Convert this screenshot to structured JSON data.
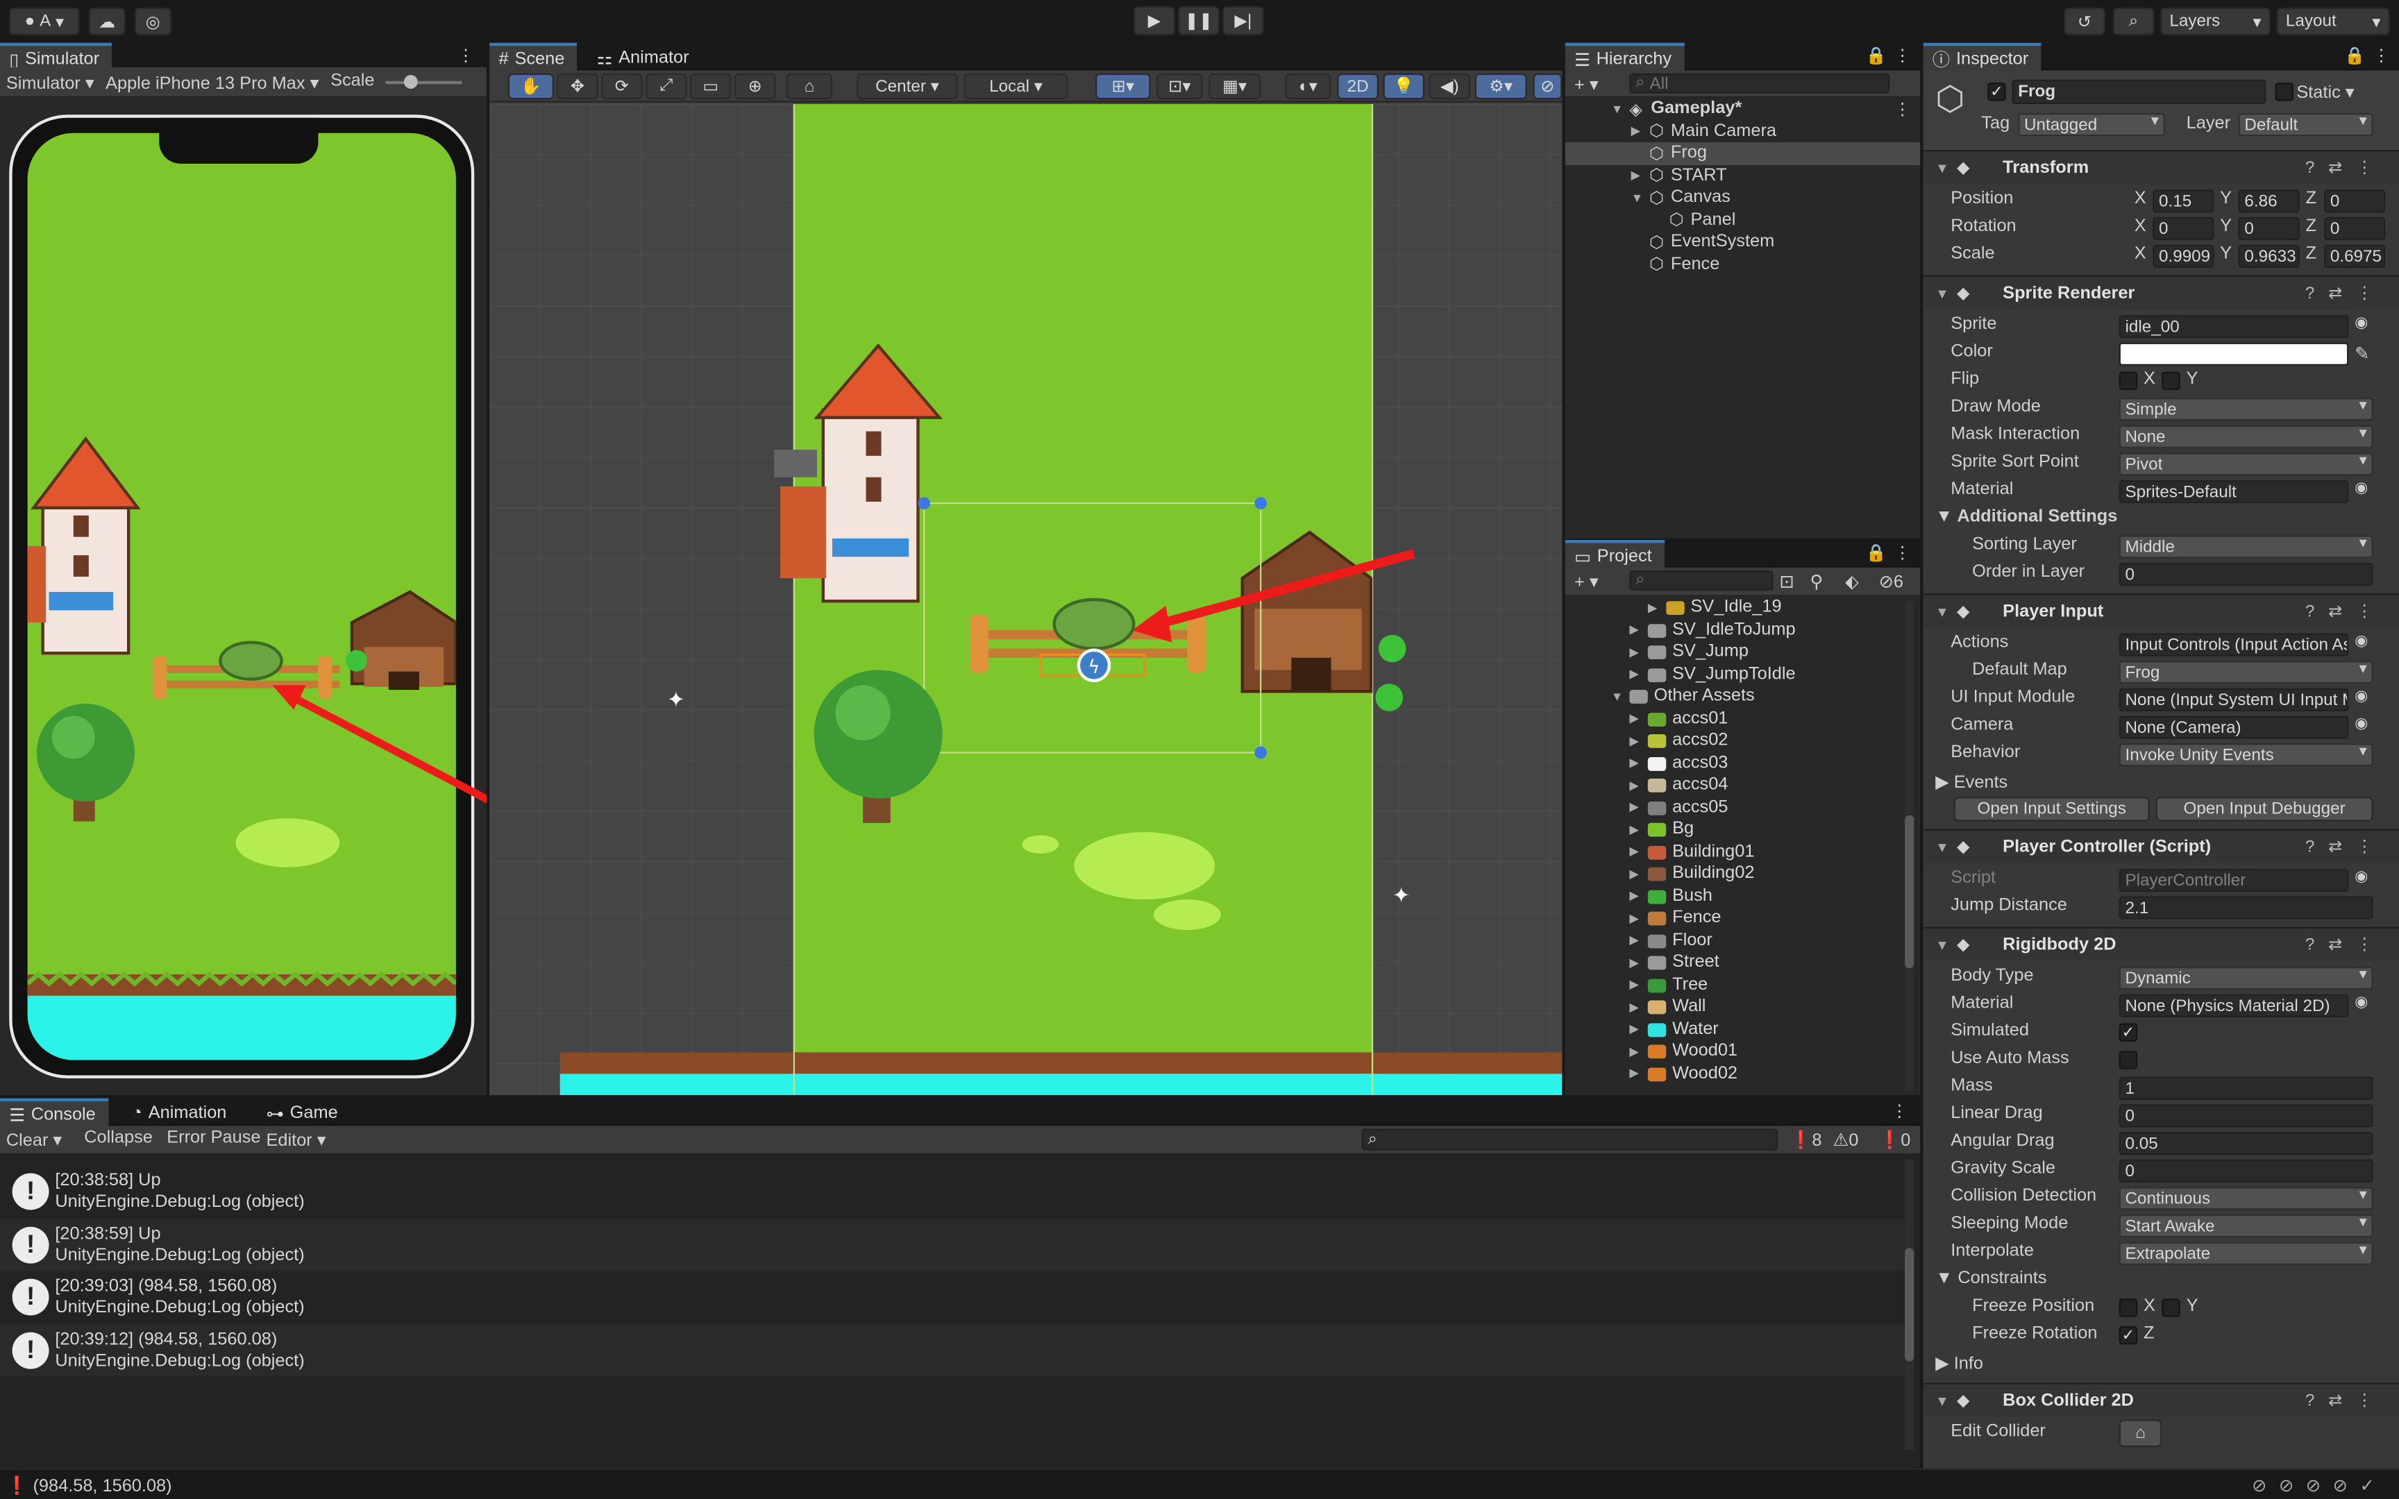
{
  "topbar": {
    "account": "A",
    "layers": "Layers",
    "layout": "Layout"
  },
  "simulator": {
    "tab": "Simulator",
    "mode": "Simulator",
    "device": "Apple iPhone 13 Pro Max",
    "scale_label": "Scale"
  },
  "scene": {
    "tabs": [
      "Scene",
      "Animator"
    ],
    "pivot": "Center",
    "space": "Local",
    "mode2d": "2D"
  },
  "hierarchy": {
    "tab": "Hierarchy",
    "search_placeholder": "All",
    "items": [
      {
        "label": "Gameplay*",
        "indent": 0
      },
      {
        "label": "Main Camera",
        "indent": 1
      },
      {
        "label": "Frog",
        "indent": 1
      },
      {
        "label": "START",
        "indent": 1
      },
      {
        "label": "Canvas",
        "indent": 1
      },
      {
        "label": "Panel",
        "indent": 2
      },
      {
        "label": "EventSystem",
        "indent": 1
      },
      {
        "label": "Fence",
        "indent": 1
      }
    ]
  },
  "project": {
    "tab": "Project",
    "hidden_count": "6",
    "items": [
      {
        "label": "SV_Idle_19",
        "indent": 3,
        "color": "#c9a227"
      },
      {
        "label": "SV_IdleToJump",
        "indent": 2,
        "color": "#b8b8b8"
      },
      {
        "label": "SV_Jump",
        "indent": 2,
        "color": "#b8b8b8"
      },
      {
        "label": "SV_JumpToIdle",
        "indent": 2,
        "color": "#b8b8b8"
      },
      {
        "label": "Other Assets",
        "indent": 1,
        "color": "#b8b8b8"
      },
      {
        "label": "accs01",
        "indent": 2,
        "color": "#6aa82f"
      },
      {
        "label": "accs02",
        "indent": 2,
        "color": "#b9c23a"
      },
      {
        "label": "accs03",
        "indent": 2,
        "color": "#f2f2f2"
      },
      {
        "label": "accs04",
        "indent": 2,
        "color": "#c8b89a"
      },
      {
        "label": "accs05",
        "indent": 2,
        "color": "#808080"
      },
      {
        "label": "Bg",
        "indent": 2,
        "color": "#7cc22b"
      },
      {
        "label": "Building01",
        "indent": 2,
        "color": "#c65a3a"
      },
      {
        "label": "Building02",
        "indent": 2,
        "color": "#8a5a3a"
      },
      {
        "label": "Bush",
        "indent": 2,
        "color": "#3fae3a"
      },
      {
        "label": "Fence",
        "indent": 2,
        "color": "#c07a3a"
      },
      {
        "label": "Floor",
        "indent": 2,
        "color": "#8a8a8a"
      },
      {
        "label": "Street",
        "indent": 2,
        "color": "#9a9a9a"
      },
      {
        "label": "Tree",
        "indent": 2,
        "color": "#3a9a3a"
      },
      {
        "label": "Wall",
        "indent": 2,
        "color": "#d8b070"
      },
      {
        "label": "Water",
        "indent": 2,
        "color": "#2fe3e0"
      },
      {
        "label": "Wood01",
        "indent": 2,
        "color": "#d87a2a"
      },
      {
        "label": "Wood02",
        "indent": 2,
        "color": "#d87a2a"
      }
    ]
  },
  "console": {
    "tabs": [
      "Console",
      "Animation",
      "Game"
    ],
    "buttons": [
      "Clear",
      "Collapse",
      "Error Pause",
      "Editor"
    ],
    "counts": {
      "info": "8",
      "warn": "0",
      "error": "0"
    },
    "logs": [
      {
        "line1": "[20:38:58] Up",
        "line2": "UnityEngine.Debug:Log (object)"
      },
      {
        "line1": "[20:38:59] Up",
        "line2": "UnityEngine.Debug:Log (object)"
      },
      {
        "line1": "[20:39:03] (984.58, 1560.08)",
        "line2": "UnityEngine.Debug:Log (object)"
      },
      {
        "line1": "[20:39:12] (984.58, 1560.08)",
        "line2": "UnityEngine.Debug:Log (object)"
      }
    ]
  },
  "status": "(984.58, 1560.08)",
  "inspector": {
    "tab": "Inspector",
    "object_name": "Frog",
    "static_label": "Static",
    "tag_label": "Tag",
    "tag": "Untagged",
    "layer_label": "Layer",
    "layer": "Default",
    "transform": {
      "title": "Transform",
      "rows": [
        {
          "label": "Position",
          "x": "0.15",
          "y": "6.86",
          "z": "0"
        },
        {
          "label": "Rotation",
          "x": "0",
          "y": "0",
          "z": "0"
        },
        {
          "label": "Scale",
          "x": "0.9909",
          "y": "0.9633",
          "z": "0.6975"
        }
      ]
    },
    "sprite_renderer": {
      "title": "Sprite Renderer",
      "fields": [
        {
          "label": "Sprite",
          "value": "idle_00",
          "kind": "obj"
        },
        {
          "label": "Color",
          "value": "",
          "kind": "color"
        },
        {
          "label": "Flip",
          "value": "",
          "kind": "flip"
        },
        {
          "label": "Draw Mode",
          "value": "Simple",
          "kind": "dd"
        },
        {
          "label": "Mask Interaction",
          "value": "None",
          "kind": "dd"
        },
        {
          "label": "Sprite Sort Point",
          "value": "Pivot",
          "kind": "dd"
        },
        {
          "label": "Material",
          "value": "Sprites-Default",
          "kind": "obj"
        }
      ],
      "additional": "Additional Settings",
      "sorting_layer_label": "Sorting Layer",
      "sorting_layer": "Middle",
      "order_label": "Order in Layer",
      "order": "0"
    },
    "player_input": {
      "title": "Player Input",
      "fields": [
        {
          "label": "Actions",
          "value": "Input Controls (Input Action Asset)",
          "kind": "obj"
        },
        {
          "label": "Default Map",
          "value": "Frog",
          "kind": "dd",
          "sub": true
        },
        {
          "label": "UI Input Module",
          "value": "None (Input System UI Input Module)",
          "kind": "obj"
        },
        {
          "label": "Camera",
          "value": "None (Camera)",
          "kind": "obj"
        },
        {
          "label": "Behavior",
          "value": "Invoke Unity Events",
          "kind": "dd"
        }
      ],
      "events": "Events",
      "btn1": "Open Input Settings",
      "btn2": "Open Input Debugger"
    },
    "player_controller": {
      "title": "Player Controller (Script)",
      "script_label": "Script",
      "script": "PlayerController",
      "jump_label": "Jump Distance",
      "jump": "2.1"
    },
    "rigidbody": {
      "title": "Rigidbody 2D",
      "fields": [
        {
          "label": "Body Type",
          "value": "Dynamic",
          "kind": "dd"
        },
        {
          "label": "Material",
          "value": "None (Physics Material 2D)",
          "kind": "obj"
        },
        {
          "label": "Simulated",
          "value": "✓",
          "kind": "chk"
        },
        {
          "label": "Use Auto Mass",
          "value": "",
          "kind": "chk"
        },
        {
          "label": "Mass",
          "value": "1",
          "kind": "txt"
        },
        {
          "label": "Linear Drag",
          "value": "0",
          "kind": "txt"
        },
        {
          "label": "Angular Drag",
          "value": "0.05",
          "kind": "txt"
        },
        {
          "label": "Gravity Scale",
          "value": "0",
          "kind": "txt"
        },
        {
          "label": "Collision Detection",
          "value": "Continuous",
          "kind": "dd"
        },
        {
          "label": "Sleeping Mode",
          "value": "Start Awake",
          "kind": "dd"
        },
        {
          "label": "Interpolate",
          "value": "Extrapolate",
          "kind": "dd"
        }
      ],
      "constraints": "Constraints",
      "freeze_pos": "Freeze Position",
      "freeze_rot": "Freeze Rotation",
      "info": "Info"
    },
    "box_collider": {
      "title": "Box Collider 2D",
      "edit_label": "Edit Collider"
    }
  }
}
